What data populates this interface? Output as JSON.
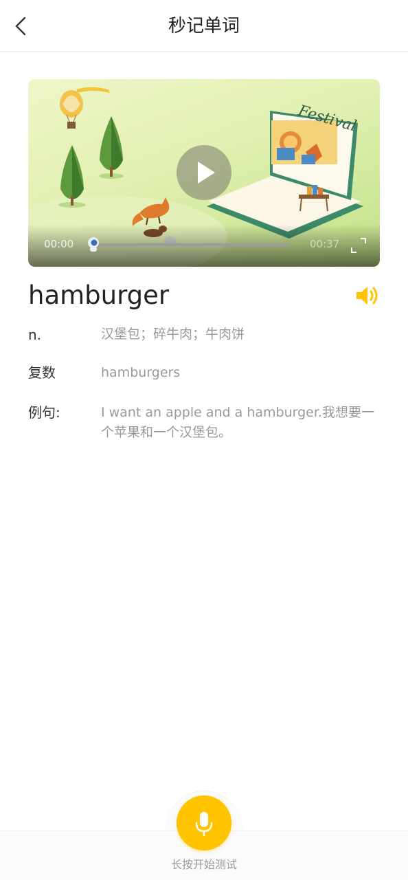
{
  "header": {
    "title": "秒记单词"
  },
  "video": {
    "current_time": "00:00",
    "total_time": "00:37",
    "progress": 0,
    "illustration_text": "Festival"
  },
  "word": {
    "text": "hamburger",
    "part_of_speech": "n.",
    "definition": "汉堡包；碎牛肉；牛肉饼",
    "plural_label": "复数",
    "plural_value": "hamburgers",
    "example_label": "例句:",
    "example_text": "I want an apple and a hamburger.我想要一个苹果和一个汉堡包。"
  },
  "bottom": {
    "mic_label": "长按开始测试"
  },
  "colors": {
    "accent": "#ffc300",
    "text_primary": "#222222",
    "text_secondary": "#999999"
  },
  "icons": {
    "back": "chevron-left-icon",
    "play": "play-icon",
    "fullscreen": "fullscreen-icon",
    "speaker": "speaker-icon",
    "mic": "microphone-icon"
  }
}
